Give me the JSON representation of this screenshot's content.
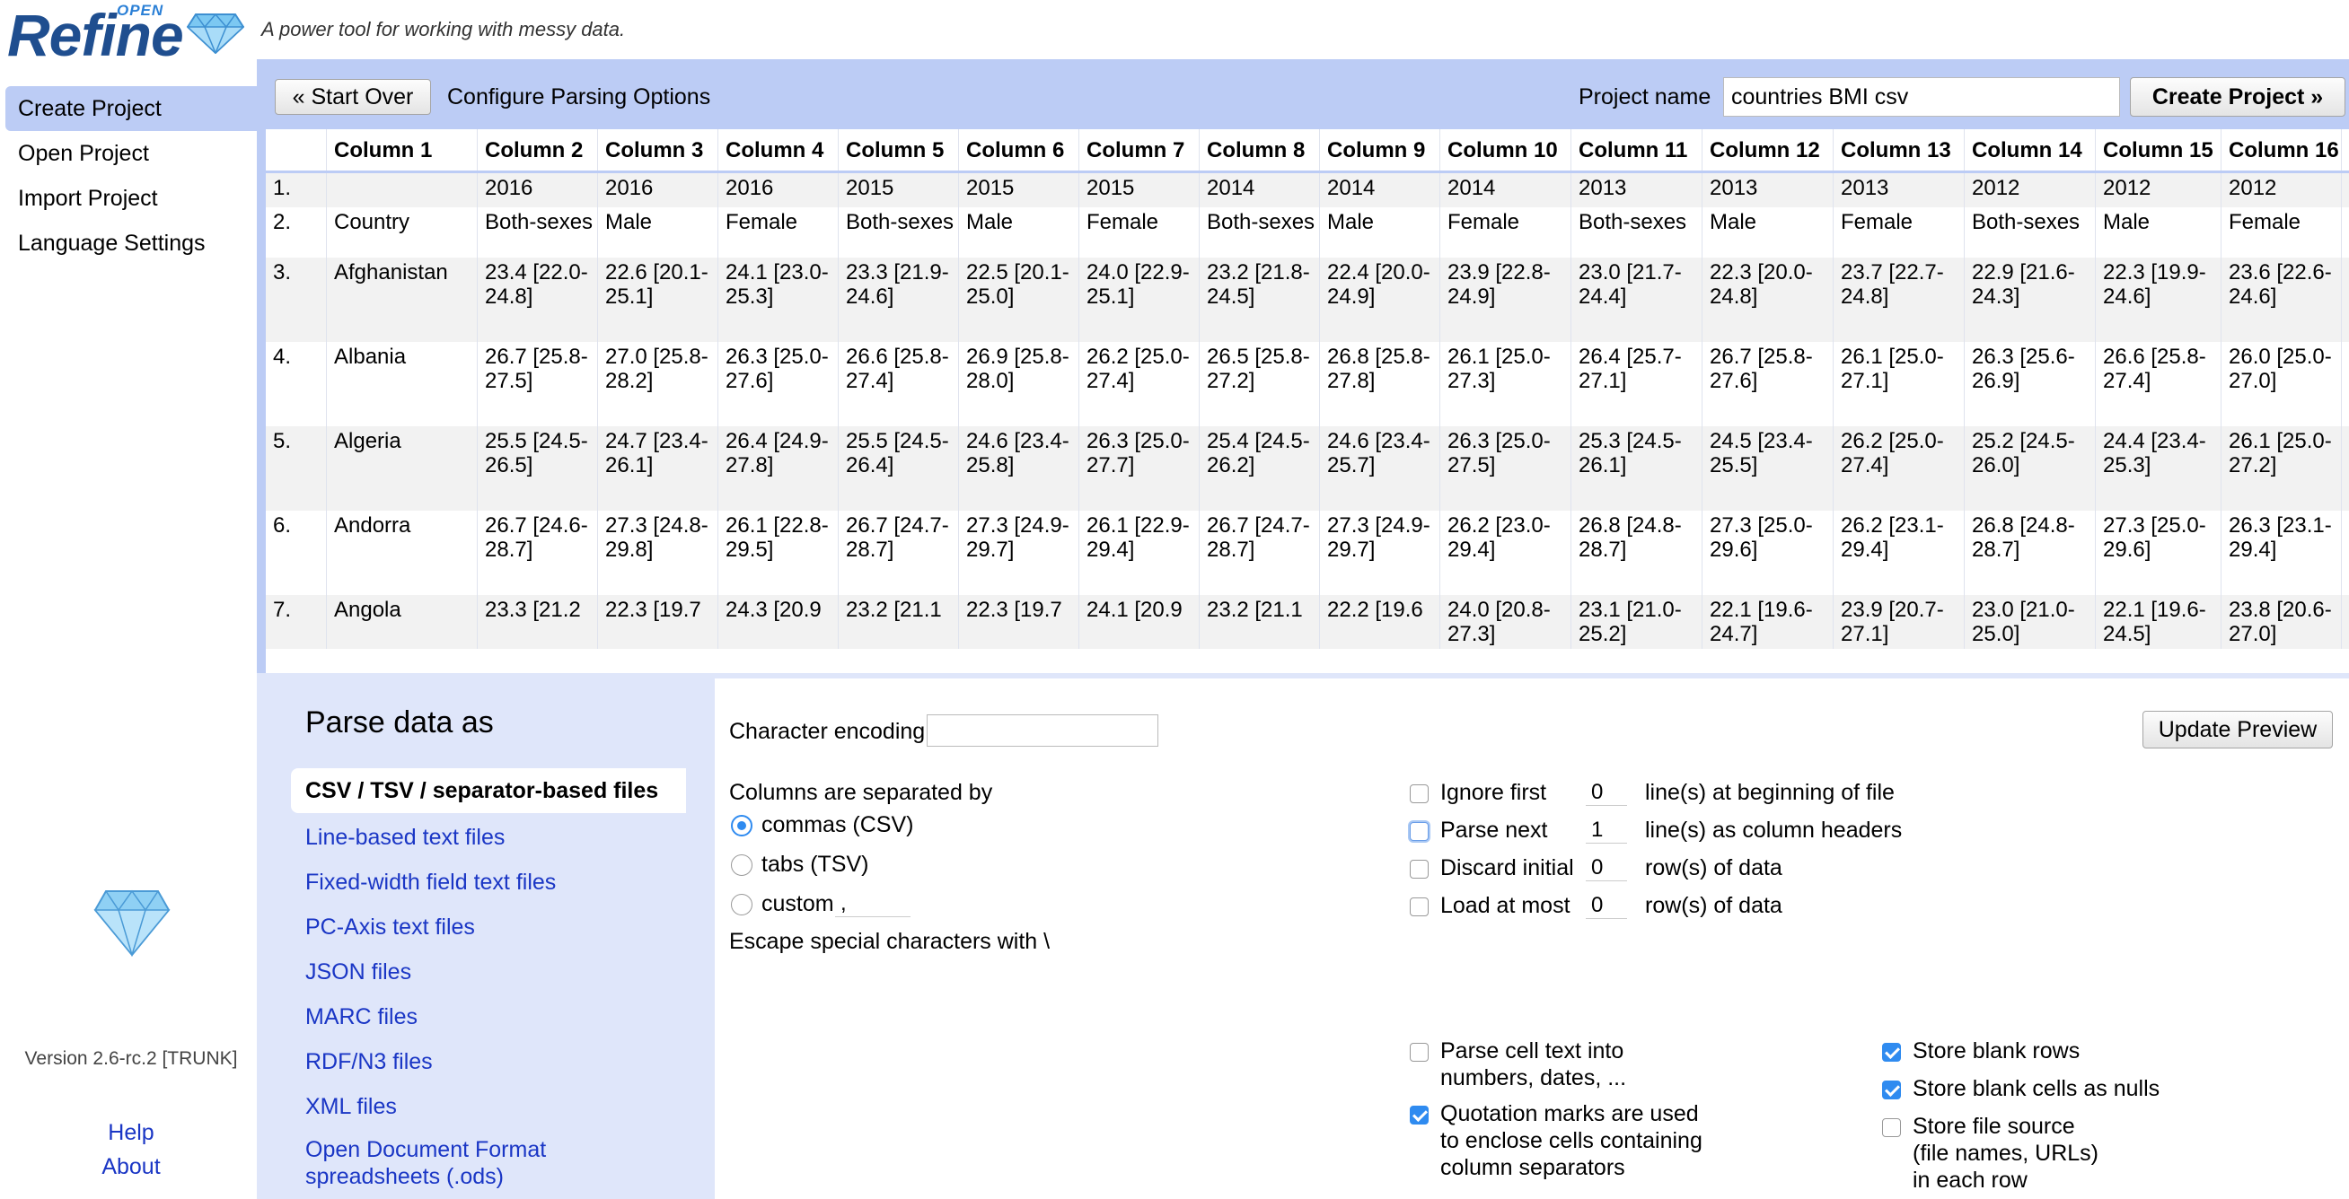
{
  "header": {
    "logo_open": "OPEN",
    "logo_word": "Refine",
    "tagline": "A power tool for working with messy data."
  },
  "sidebar": {
    "items": [
      {
        "label": "Create Project",
        "active": true
      },
      {
        "label": "Open Project"
      },
      {
        "label": "Import Project"
      },
      {
        "label": "Language Settings"
      }
    ],
    "version": "Version 2.6-rc.2 [TRUNK]",
    "help": "Help",
    "about": "About"
  },
  "toolbar": {
    "start_over": "« Start Over",
    "configure_title": "Configure Parsing Options",
    "project_name_label": "Project name",
    "project_name_value": "countries BMI csv",
    "create_project": "Create Project »"
  },
  "table": {
    "columns": [
      "Column 1",
      "Column 2",
      "Column 3",
      "Column 4",
      "Column 5",
      "Column 6",
      "Column 7",
      "Column 8",
      "Column 9",
      "Column 10",
      "Column 11",
      "Column 12",
      "Column 13",
      "Column 14",
      "Column 15",
      "Column 16"
    ],
    "rows": [
      {
        "num": "1.",
        "cells": [
          "",
          "2016",
          "2016",
          "2016",
          "2015",
          "2015",
          "2015",
          "2014",
          "2014",
          "2014",
          "2013",
          "2013",
          "2013",
          "2012",
          "2012",
          "2012"
        ]
      },
      {
        "num": "2.",
        "cells": [
          "Country",
          "Both-sexes",
          "Male",
          "Female",
          "Both-sexes",
          "Male",
          "Female",
          "Both-sexes",
          "Male",
          "Female",
          "Both-sexes",
          "Male",
          "Female",
          "Both-sexes",
          "Male",
          "Female"
        ]
      },
      {
        "num": "3.",
        "cells": [
          "Afghanistan",
          "23.4 [22.0-24.8]",
          "22.6 [20.1-25.1]",
          "24.1 [23.0-25.3]",
          "23.3 [21.9-24.6]",
          "22.5 [20.1-25.0]",
          "24.0 [22.9-25.1]",
          "23.2 [21.8-24.5]",
          "22.4 [20.0-24.9]",
          "23.9 [22.8-24.9]",
          "23.0 [21.7-24.4]",
          "22.3 [20.0-24.8]",
          "23.7 [22.7-24.8]",
          "22.9 [21.6-24.3]",
          "22.3 [19.9-24.6]",
          "23.6 [22.6-24.6]"
        ]
      },
      {
        "num": "4.",
        "cells": [
          "Albania",
          "26.7 [25.8-27.5]",
          "27.0 [25.8-28.2]",
          "26.3 [25.0-27.6]",
          "26.6 [25.8-27.4]",
          "26.9 [25.8-28.0]",
          "26.2 [25.0-27.4]",
          "26.5 [25.8-27.2]",
          "26.8 [25.8-27.8]",
          "26.1 [25.0-27.3]",
          "26.4 [25.7-27.1]",
          "26.7 [25.8-27.6]",
          "26.1 [25.0-27.1]",
          "26.3 [25.6-26.9]",
          "26.6 [25.8-27.4]",
          "26.0 [25.0-27.0]"
        ]
      },
      {
        "num": "5.",
        "cells": [
          "Algeria",
          "25.5 [24.5-26.5]",
          "24.7 [23.4-26.1]",
          "26.4 [24.9-27.8]",
          "25.5 [24.5-26.4]",
          "24.6 [23.4-25.8]",
          "26.3 [25.0-27.7]",
          "25.4 [24.5-26.2]",
          "24.6 [23.4-25.7]",
          "26.3 [25.0-27.5]",
          "25.3 [24.5-26.1]",
          "24.5 [23.4-25.5]",
          "26.2 [25.0-27.4]",
          "25.2 [24.5-26.0]",
          "24.4 [23.4-25.3]",
          "26.1 [25.0-27.2]"
        ]
      },
      {
        "num": "6.",
        "cells": [
          "Andorra",
          "26.7 [24.6-28.7]",
          "27.3 [24.8-29.8]",
          "26.1 [22.8-29.5]",
          "26.7 [24.7-28.7]",
          "27.3 [24.9-29.7]",
          "26.1 [22.9-29.4]",
          "26.7 [24.7-28.7]",
          "27.3 [24.9-29.7]",
          "26.2 [23.0-29.4]",
          "26.8 [24.8-28.7]",
          "27.3 [25.0-29.6]",
          "26.2 [23.1-29.4]",
          "26.8 [24.8-28.7]",
          "27.3 [25.0-29.6]",
          "26.3 [23.1-29.4]"
        ]
      },
      {
        "num": "7.",
        "cells": [
          "Angola",
          "23.3 [21.2",
          "22.3 [19.7",
          "24.3 [20.9",
          "23.2 [21.1",
          "22.3 [19.7",
          "24.1 [20.9",
          "23.2 [21.1",
          "22.2 [19.6",
          "24.0 [20.8-27.3]",
          "23.1 [21.0-25.2]",
          "22.1 [19.6-24.7]",
          "23.9 [20.7-27.1]",
          "23.0 [21.0-25.0]",
          "22.1 [19.6-24.5]",
          "23.8 [20.6-27.0]"
        ]
      }
    ]
  },
  "parse": {
    "title": "Parse data as",
    "formats": [
      "CSV / TSV / separator-based files",
      "Line-based text files",
      "Fixed-width field text files",
      "PC-Axis text files",
      "JSON files",
      "MARC files",
      "RDF/N3 files",
      "XML files",
      "Open Document Format spreadsheets (.ods)"
    ],
    "selected_format_index": 0,
    "character_encoding_label": "Character encoding",
    "character_encoding_value": "",
    "update_preview": "Update Preview",
    "separator": {
      "label": "Columns are separated by",
      "options": [
        "commas (CSV)",
        "tabs (TSV)",
        "custom"
      ],
      "selected": 0,
      "custom_value": ","
    },
    "escape_label": "Escape special characters with \\",
    "line_options": [
      {
        "label": "Ignore first",
        "value": "0",
        "suffix": "line(s) at beginning of file",
        "checked": false
      },
      {
        "label": "Parse next",
        "value": "1",
        "suffix": "line(s) as column headers",
        "checked": false,
        "focused": true
      },
      {
        "label": "Discard initial",
        "value": "0",
        "suffix": "row(s) of data",
        "checked": false
      },
      {
        "label": "Load at most",
        "value": "0",
        "suffix": "row(s) of data",
        "checked": false
      }
    ],
    "parse_cells": {
      "label_1": "Parse cell text into",
      "label_2": "numbers, dates, ...",
      "checked": false
    },
    "quotation": {
      "label_1": "Quotation marks are used",
      "label_2": "to enclose cells containing",
      "label_3": "column separators",
      "checked": true
    },
    "store_blank_rows": {
      "label": "Store blank rows",
      "checked": true
    },
    "store_blank_cells": {
      "label": "Store blank cells as nulls",
      "checked": true
    },
    "store_file_source": {
      "label_1": "Store file source",
      "label_2": "(file names, URLs)",
      "label_3": "in each row",
      "checked": false
    }
  },
  "colors": {
    "accent_panel": "#bcccf5",
    "link": "#1a36c5",
    "checkbox_on": "#2f8bf0",
    "logo": "#1f4e8f"
  }
}
